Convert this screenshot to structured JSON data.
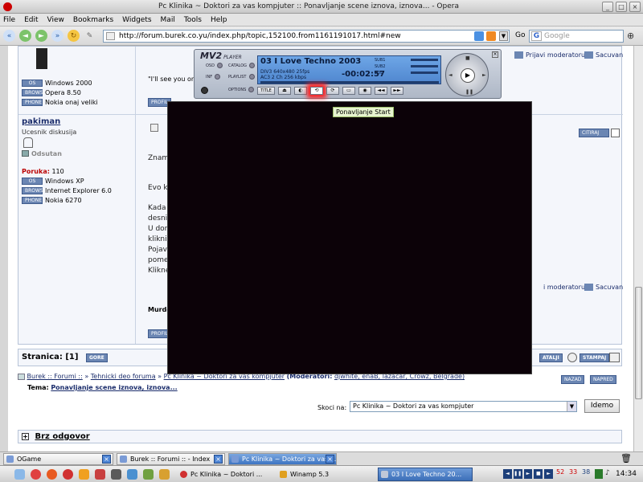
{
  "window": {
    "title": "Pc Klinika ~ Doktori za vas kompjuter :: Ponavljanje scene iznova, iznova... - Opera"
  },
  "menu": [
    "File",
    "Edit",
    "View",
    "Bookmarks",
    "Widgets",
    "Mail",
    "Tools",
    "Help"
  ],
  "address": {
    "url": "http://forum.burek.co.yu/index.php/topic,152100.from1161191017.html#new",
    "go_label": "Go",
    "search_placeholder": "Google"
  },
  "post1": {
    "info": [
      {
        "badge": "OS",
        "value": "Windows 2000"
      },
      {
        "badge": "BROWSER",
        "value": "Opera 8.50"
      },
      {
        "badge": "PHONE",
        "value": "Nokia onaj veliki"
      }
    ],
    "profile_btn": "PROFIL",
    "quote_text": "\"I'll see you on the b",
    "mod_report": "Prijavi moderatoru",
    "save": "Sacuvan"
  },
  "post2": {
    "username": "pakiman",
    "rank": "Ucesnik diskusija",
    "status": "Odsutan",
    "posts_label": "Poruka:",
    "posts_count": "110",
    "info": [
      {
        "badge": "OS",
        "value": "Windows XP"
      },
      {
        "badge": "BROWSER",
        "value": "Internet Explorer 6.0"
      },
      {
        "badge": "PHONE",
        "value": "Nokia 6270"
      }
    ],
    "cite_btn": "CITIRAJ",
    "text_lines": [
      "Znam c",
      "Evo kak",
      "Kada pu",
      "desnim",
      "U donje",
      "klikni d",
      "Pojavic",
      "pomeri",
      "Kliknes"
    ],
    "mod_report": "i moderatoru",
    "save": "Sacuvan",
    "signature": "Murder :",
    "profile_btn": "PROFIL"
  },
  "pagination": {
    "label": "Stranica: [1]",
    "more_btn": "GORE",
    "actions": [
      "ATALJI",
      "STAMPAJ"
    ]
  },
  "breadcrumb": {
    "items": [
      "Burek :: Forumi ::",
      "Tehnicki deo foruma",
      "Pc Klinika ~ Doktori za vas kompjuter"
    ],
    "moderators_label": "(Moderatori:",
    "moderators": "djwhite, enaB, lazacar, Crowz, Belgrade)",
    "nav_buttons": [
      "NAZAD",
      "NAPRED"
    ],
    "topic_label": "Tema:",
    "topic": "Ponavljanje scene iznova, iznova..."
  },
  "jump": {
    "label": "Skoci na:",
    "selected": "Pc Klinika ~ Doktori za vas kompjuter",
    "button": "Idemo"
  },
  "quick_reply": {
    "title": "Brz odgovor"
  },
  "player": {
    "logo": "MV2",
    "logo_sub": "PLAYER",
    "side_buttons": [
      "OSD",
      "INF",
      "OPTIONS",
      "CATALOG",
      "PLAYLIST"
    ],
    "track": "03 I Love Techno 2003",
    "video_line": "DIV3   640x480   25fps",
    "audio_line": "AC3    2 Ch    256 kbps",
    "time": "-00:02:57",
    "sub_labels": [
      "SUB1",
      "SUB2",
      "VOL"
    ],
    "title_btn": "TITLE",
    "tooltip": "Ponavljanje Start"
  },
  "tabs": [
    {
      "label": "OGame",
      "active": false
    },
    {
      "label": "Burek :: Forumi :: - Index",
      "active": false
    },
    {
      "label": "Pc Klinika ~ Doktori za vas ...",
      "active": true
    }
  ],
  "taskbar": {
    "tasks": [
      {
        "label": "Pc Klinika ~ Doktori ...",
        "active": false
      },
      {
        "label": "Winamp 5.3",
        "active": false
      },
      {
        "label": "03 I Love Techno 20...",
        "active": true
      }
    ],
    "tray_numbers": [
      "52",
      "33",
      "38"
    ],
    "clock": "14:34"
  }
}
